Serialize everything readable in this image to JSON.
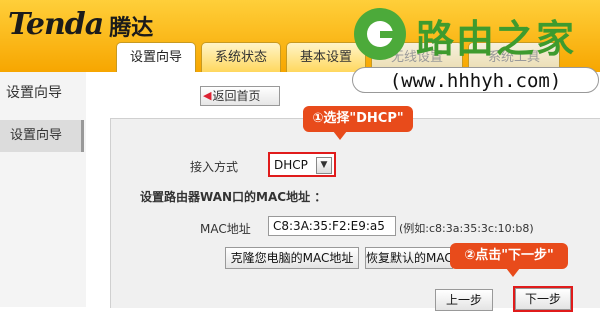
{
  "brand": {
    "name_en": "Tenda",
    "name_cn": "腾达"
  },
  "tabs": [
    {
      "label": "设置向导"
    },
    {
      "label": "系统状态"
    },
    {
      "label": "基本设置"
    },
    {
      "label": "无线设置"
    },
    {
      "label": "系统工具"
    }
  ],
  "watermark": {
    "text": "路由之家",
    "url": "(www.hhhyh.com)"
  },
  "sidebar": {
    "title": "设置向导",
    "items": [
      {
        "label": "设置向导"
      }
    ]
  },
  "toolbar": {
    "back_label": "返回首页"
  },
  "form": {
    "access_label": "接入方式",
    "access_value": "DHCP",
    "mac_section_title": "设置路由器WAN口的MAC地址 ：",
    "mac_label": "MAC地址",
    "mac_value": "C8:3A:35:F2:E9:a5",
    "mac_example": "(例如:c8:3a:35:3c:10:b8)",
    "clone_mac_button": "克隆您电脑的MAC地址",
    "restore_mac_button": "恢复默认的MAC地址",
    "prev_button": "上一步",
    "next_button": "下一步"
  },
  "annotations": {
    "step1": "①选择\"DHCP\"",
    "step2": "②点击\"下一步\""
  },
  "colors": {
    "header": "#f7b21b",
    "accent_red": "#e84b1b",
    "watermark_green": "#3e9b2e"
  }
}
